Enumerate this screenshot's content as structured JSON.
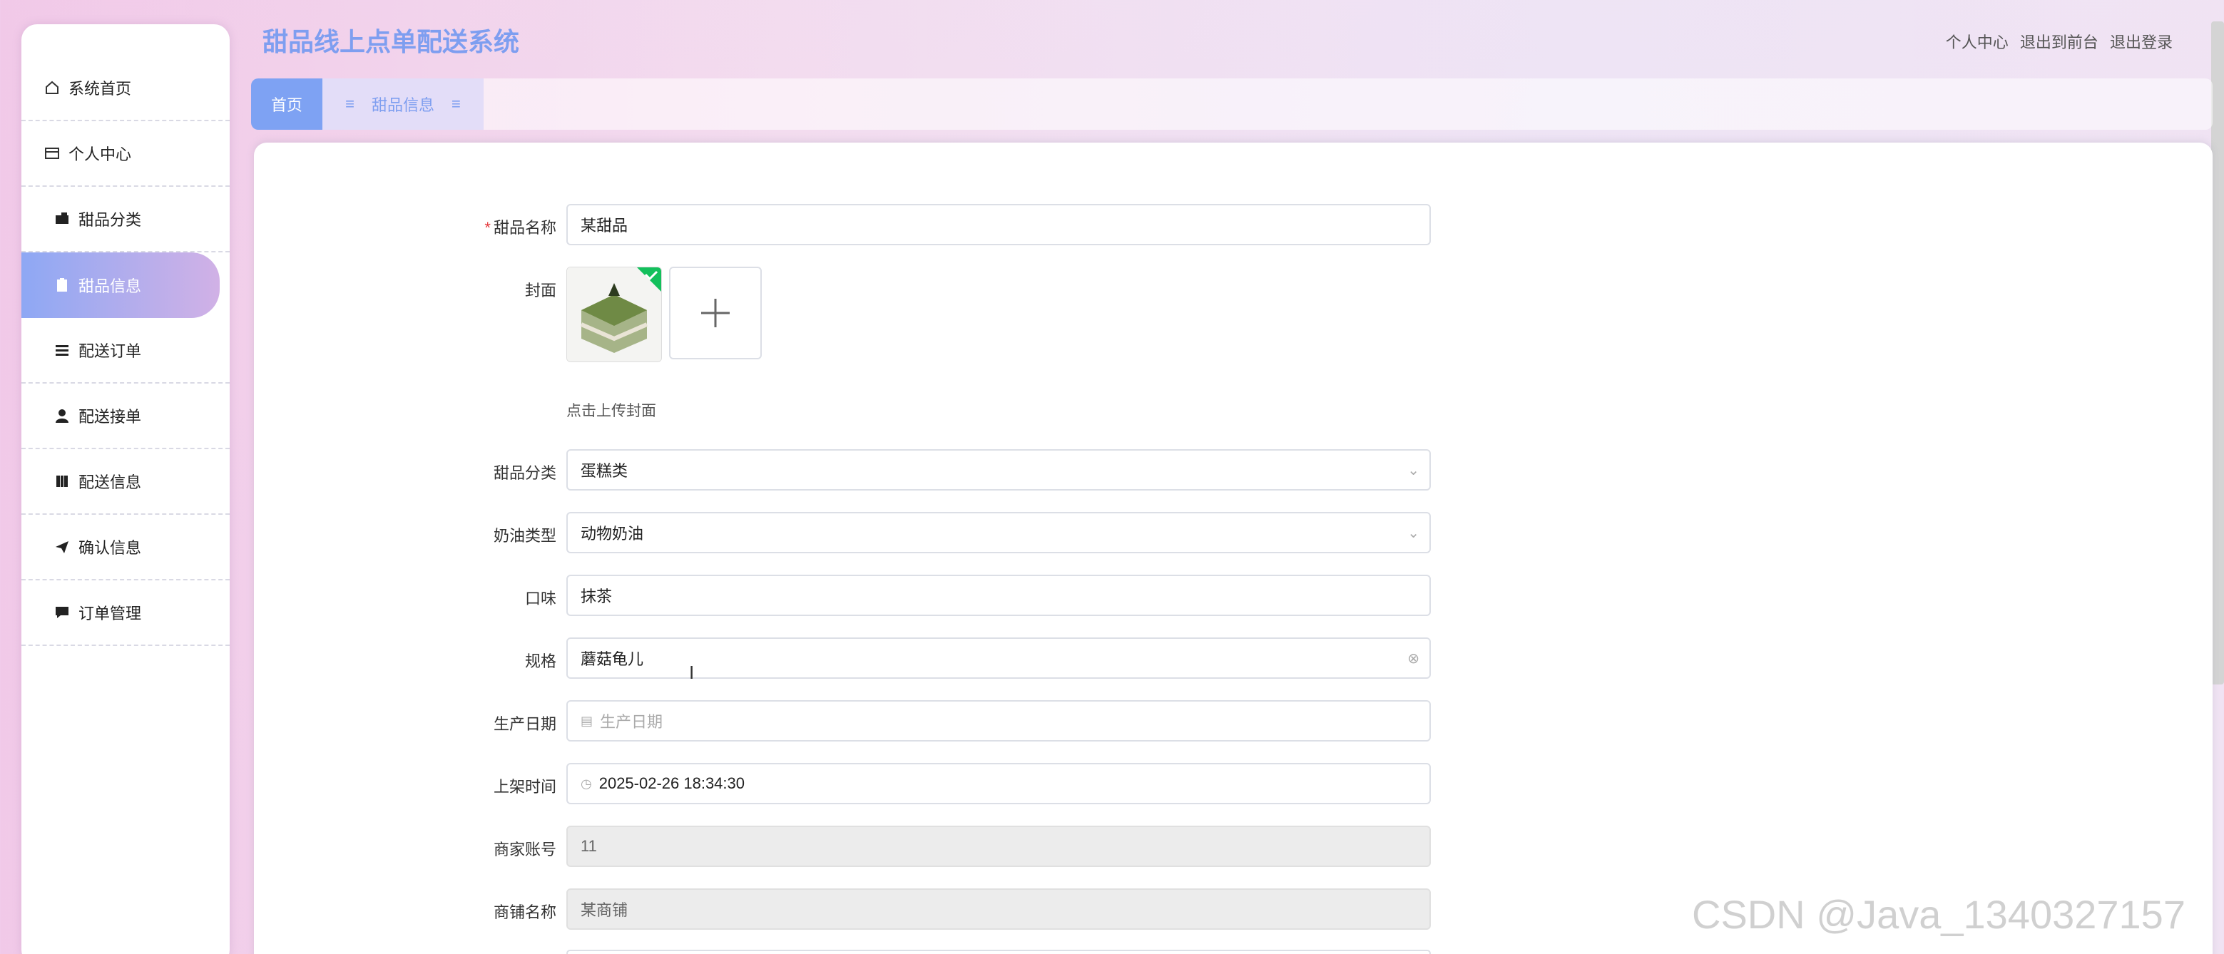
{
  "app_title": "甜品线上点单配送系统",
  "header_links": [
    "个人中心",
    "退出到前台",
    "退出登录"
  ],
  "sidebar": {
    "items": [
      {
        "label": "系统首页",
        "icon": "home-icon"
      },
      {
        "label": "个人中心",
        "icon": "profile-icon"
      },
      {
        "label": "甜品分类",
        "icon": "wallet-icon"
      },
      {
        "label": "甜品信息",
        "icon": "clipboard-icon",
        "active": true
      },
      {
        "label": "配送订单",
        "icon": "list-icon"
      },
      {
        "label": "配送接单",
        "icon": "user-icon"
      },
      {
        "label": "配送信息",
        "icon": "book-icon"
      },
      {
        "label": "确认信息",
        "icon": "send-icon"
      },
      {
        "label": "订单管理",
        "icon": "chat-icon"
      }
    ]
  },
  "tabs": {
    "home": "首页",
    "current": "甜品信息"
  },
  "form": {
    "name_label": "甜品名称",
    "name_value": "某甜品",
    "cover_label": "封面",
    "cover_hint": "点击上传封面",
    "category_label": "甜品分类",
    "category_value": "蛋糕类",
    "cream_label": "奶油类型",
    "cream_value": "动物奶油",
    "flavor_label": "口味",
    "flavor_value": "抹茶",
    "spec_label": "规格",
    "spec_value": "蘑菇龟儿",
    "production_date_label": "生产日期",
    "production_date_placeholder": "生产日期",
    "listing_time_label": "上架时间",
    "listing_time_value": "2025-02-26 18:34:30",
    "merchant_account_label": "商家账号",
    "merchant_account_value": "11",
    "shop_name_label": "商铺名称",
    "shop_name_value": "某商铺"
  },
  "watermark": "CSDN @Java_1340327157",
  "colors": {
    "accent": "#7e9ef0",
    "active_gradient_start": "#8ea8f4",
    "active_gradient_end": "#d1b1e6",
    "required": "#e4393c"
  }
}
